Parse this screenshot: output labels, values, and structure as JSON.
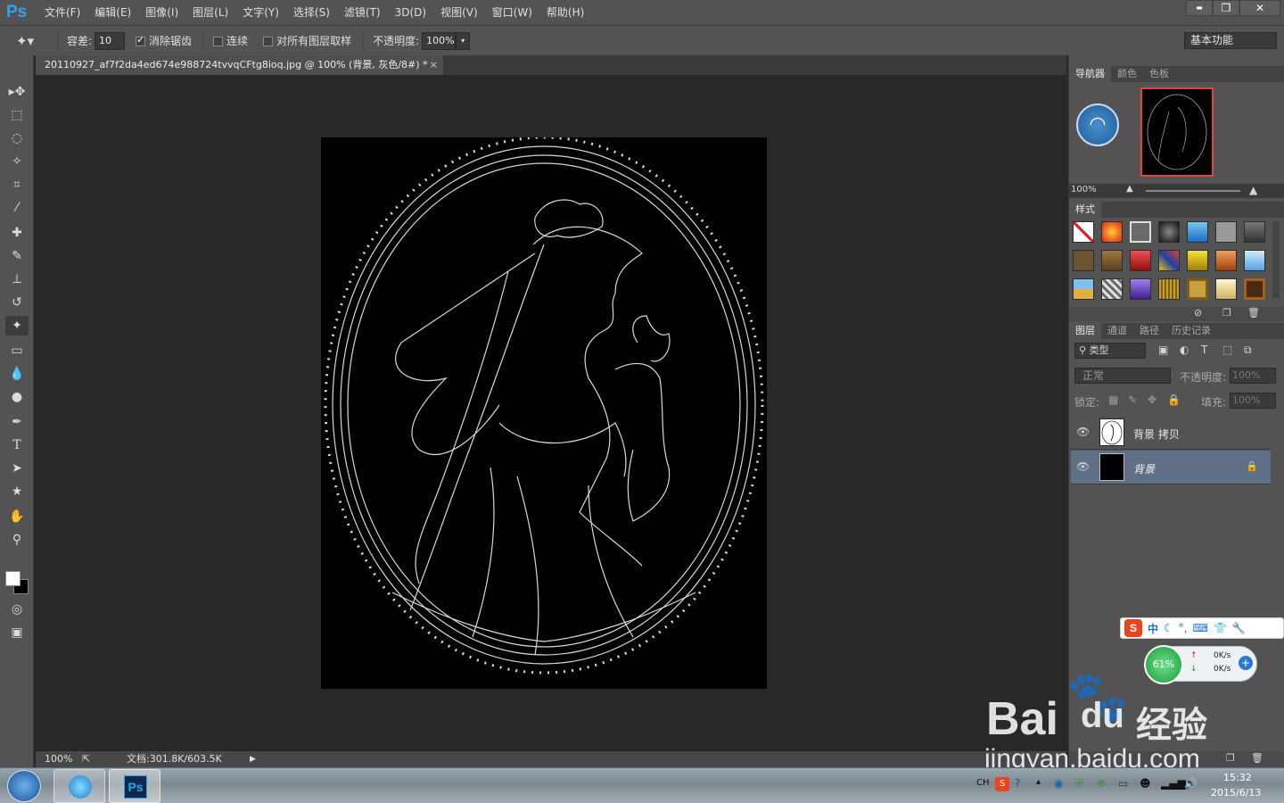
{
  "app": {
    "logo": "Ps"
  },
  "menu": [
    "文件(F)",
    "编辑(E)",
    "图像(I)",
    "图层(L)",
    "文字(Y)",
    "选择(S)",
    "滤镜(T)",
    "3D(D)",
    "视图(V)",
    "窗口(W)",
    "帮助(H)"
  ],
  "window_controls": {
    "minimize": "▬",
    "restore": "❐",
    "close": "✕"
  },
  "options": {
    "tolerance_label": "容差:",
    "tolerance_value": "10",
    "antialias_label": "消除锯齿",
    "contiguous_label": "连续",
    "sample_all_label": "对所有图层取样",
    "opacity_label": "不透明度:",
    "opacity_value": "100%",
    "workspace": "基本功能"
  },
  "document": {
    "tab_title": "20110927_af7f2da4ed674e988724tvvqCFtg8ioq.jpg @ 100% (背景, 灰色/8#) *",
    "close": "×"
  },
  "status": {
    "zoom": "100%",
    "doc_info": "文档:301.8K/603.5K"
  },
  "navigator": {
    "tabs": [
      "导航器",
      "颜色",
      "色板"
    ],
    "zoom": "100%"
  },
  "styles": {
    "tab": "样式"
  },
  "layers": {
    "tabs": [
      "图层",
      "通道",
      "路径",
      "历史记录"
    ],
    "filter_label": "类型",
    "blend_mode": "正常",
    "opacity_label": "不透明度:",
    "opacity_value": "100%",
    "lock_label": "锁定:",
    "fill_label": "填充:",
    "fill_value": "100%",
    "items": [
      {
        "name": "背景 拷贝"
      },
      {
        "name": "背景"
      }
    ]
  },
  "ime": {
    "sogou": "S",
    "lang": "中"
  },
  "net_widget": {
    "percent": "61%",
    "up": "0K/s",
    "down": "0K/s"
  },
  "watermark": {
    "brand": "Bai",
    "brand2": "du",
    "cn": "经验",
    "url": "jingyan.baidu.com"
  },
  "taskbar": {
    "ps_icon": "Ps",
    "tray_lang": "CH",
    "time": "15:32",
    "date": "2015/6/13"
  },
  "colors": {
    "accent": "#2fa3f0",
    "selected_layer": "#5e6f86",
    "panel_bg": "#535353",
    "canvas_bg": "#282828"
  }
}
